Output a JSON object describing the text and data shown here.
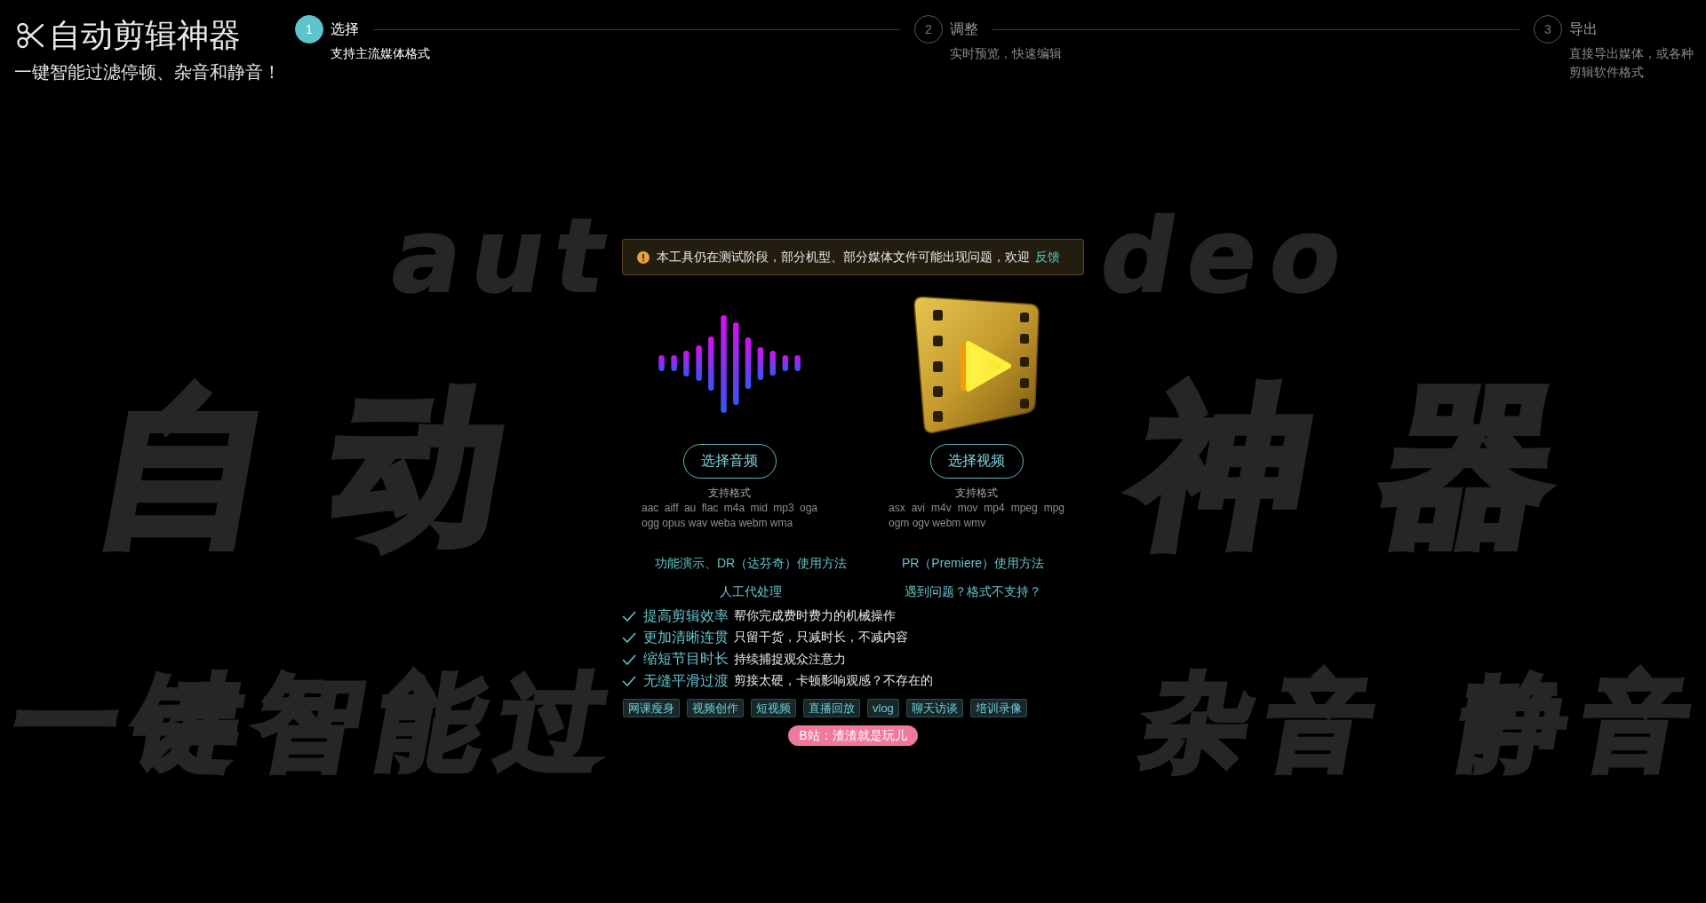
{
  "header": {
    "title": "自动剪辑神器",
    "subtitle": "一键智能过滤停顿、杂音和静音！"
  },
  "steps": [
    {
      "number": "1",
      "title": "选择",
      "description": "支持主流媒体格式",
      "selected": true
    },
    {
      "number": "2",
      "title": "调整",
      "description": "实时预览，快速编辑",
      "selected": false
    },
    {
      "number": "3",
      "title": "导出",
      "description": "直接导出媒体，或各种剪辑软件格式",
      "selected": false
    }
  ],
  "background_text": {
    "top": [
      "aut",
      "deo"
    ],
    "middle": [
      "自动",
      "神器"
    ],
    "bottom": [
      "一键智能过",
      "杂音",
      "静音"
    ]
  },
  "notice": {
    "text": "本工具仍在测试阶段，部分机型、部分媒体文件可能出现问题，欢迎",
    "link": "反馈"
  },
  "media": [
    {
      "kind": "audio",
      "button": "选择音频",
      "formats_label": "支持格式",
      "formats": "aac aiff au flac m4a mid mp3 oga ogg opus wav weba webm wma"
    },
    {
      "kind": "video",
      "button": "选择视频",
      "formats_label": "支持格式",
      "formats": "asx avi m4v mov mp4 mpeg mpg ogm ogv webm wmv"
    }
  ],
  "links": [
    "功能演示、DR（达芬奇）使用方法",
    "PR（Premiere）使用方法",
    "人工代处理",
    "遇到问题？格式不支持？"
  ],
  "features": [
    {
      "title": "提高剪辑效率",
      "description": "帮你完成费时费力的机械操作"
    },
    {
      "title": "更加清晰连贯",
      "description": "只留干货，只减时长，不减内容"
    },
    {
      "title": "缩短节目时长",
      "description": "持续捕捉观众注意力"
    },
    {
      "title": "无缝平滑过渡",
      "description": "剪接太硬，卡顿影响观感？不存在的"
    }
  ],
  "tags": [
    "网课瘦身",
    "视频创作",
    "短视频",
    "直播回放",
    "vlog",
    "聊天访谈",
    "培训录像"
  ],
  "badge": "B站：渣渣就是玩儿"
}
